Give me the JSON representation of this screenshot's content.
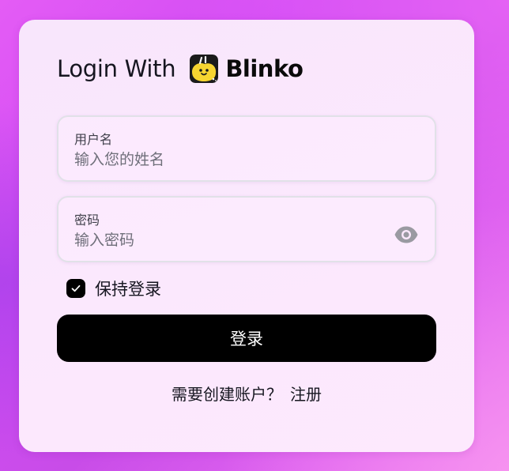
{
  "header": {
    "title_prefix": "Login With",
    "brand_name": "Blinko",
    "logo_icon": "blinko-logo-icon"
  },
  "form": {
    "username": {
      "label": "用户名",
      "placeholder": "输入您的姓名",
      "value": ""
    },
    "password": {
      "label": "密码",
      "placeholder": "输入密码",
      "value": "",
      "toggle_icon": "eye-icon"
    },
    "remember": {
      "label": "保持登录",
      "checked": true,
      "icon": "checkmark-icon"
    },
    "submit_label": "登录"
  },
  "footer": {
    "prompt": "需要创建账户？",
    "link_label": "注册"
  },
  "colors": {
    "accent": "#000000",
    "card_bg": "#fbe8fd",
    "background_start": "#e45cf5",
    "background_end": "#f07ef0",
    "logo_yellow": "#f7d531"
  }
}
